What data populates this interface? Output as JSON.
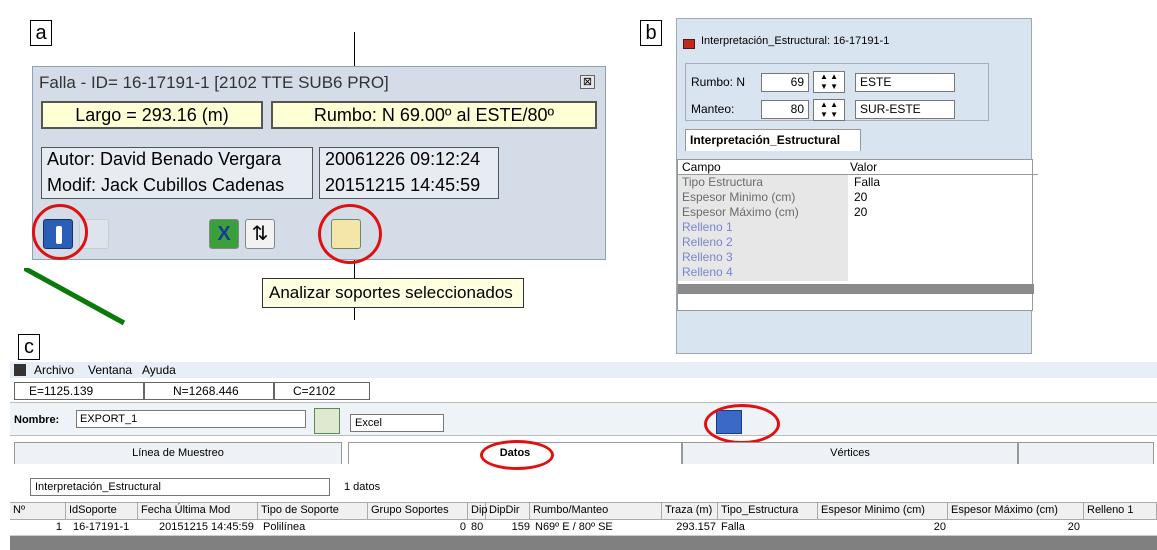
{
  "panels": {
    "a": "a",
    "b": "b",
    "c": "c"
  },
  "falla": {
    "title": "Falla - ID= 16-17191-1 [2102 TTE SUB6 PRO]",
    "largo": "Largo = 293.16 (m)",
    "rumbo": "Rumbo: N 69.00º al ESTE/80º",
    "autor": "Autor: David Benado Vergara",
    "autor_date": "20061226 09:12:24",
    "modif": "Modif: Jack Cubillos Cadenas",
    "modif_date": "20151215 14:45:59",
    "tooltip": "Analizar soportes seleccionados",
    "close": "⊠"
  },
  "interp": {
    "title": "Interpretación_Estructural: 16-17191-1",
    "rumbo_label": "Rumbo: N",
    "rumbo_value": "69",
    "rumbo_dir": "ESTE",
    "manteo_label": "Manteo:",
    "manteo_value": "80",
    "manteo_dir": "SUR-ESTE",
    "tab": "Interpretación_Estructural",
    "headers": [
      "Campo",
      "Valor"
    ],
    "rows": [
      [
        "Tipo Estructura",
        "Falla"
      ],
      [
        "Espesor Minimo (cm)",
        "20"
      ],
      [
        "Espesor Máximo (cm)",
        "20"
      ],
      [
        "Relleno 1",
        ""
      ],
      [
        "Relleno 2",
        ""
      ],
      [
        "Relleno 3",
        ""
      ],
      [
        "Relleno 4",
        ""
      ]
    ]
  },
  "app": {
    "menu": [
      "Archivo",
      "Ventana",
      "Ayuda"
    ],
    "e": "E=1125.139",
    "n": "N=1268.446",
    "c": "C=2102",
    "nombre_label": "Nombre:",
    "nombre_value": "EXPORT_1",
    "format": "Excel",
    "tabs": [
      "Línea de Muestreo",
      "Datos",
      "Vértices"
    ],
    "dataset": "Interpretación_Estructural",
    "count": "1 datos",
    "headers": [
      "Nº",
      "IdSoporte",
      "Fecha Última Mod",
      "Tipo de Soporte",
      "Grupo Soportes",
      "Dip",
      "DipDir",
      "Rumbo/Manteo",
      "Traza (m)",
      "Tipo_Estructura",
      "Espesor Minimo (cm)",
      "Espesor Máximo (cm)",
      "Relleno 1"
    ],
    "row": [
      "1",
      "16-17191-1",
      "20151215 14:45:59",
      "Polilínea",
      "0",
      "80",
      "159",
      "N69º E / 80º SE",
      "293.157",
      "Falla",
      "20",
      "20",
      ""
    ]
  },
  "colors": {
    "highlight": "#e01010",
    "panel": "#d4dde7",
    "accent": "#1a3a9a"
  }
}
